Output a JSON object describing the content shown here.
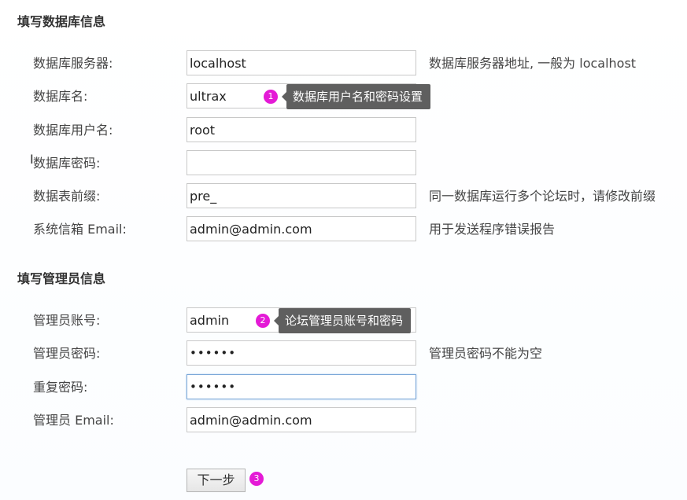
{
  "sections": {
    "database": {
      "title": "填写数据库信息"
    },
    "admin": {
      "title": "填写管理员信息"
    }
  },
  "database_fields": [
    {
      "label": "数据库服务器:",
      "value": "localhost",
      "hint": "数据库服务器地址, 一般为 localhost"
    },
    {
      "label": "数据库名:",
      "value": "ultrax",
      "hint": ""
    },
    {
      "label": "数据库用户名:",
      "value": "root",
      "hint": ""
    },
    {
      "label": "数据库密码:",
      "value": "",
      "hint": ""
    },
    {
      "label": "数据表前缀:",
      "value": "pre_",
      "hint": "同一数据库运行多个论坛时，请修改前缀"
    },
    {
      "label": "系统信箱 Email:",
      "value": "admin@admin.com",
      "hint": "用于发送程序错误报告"
    }
  ],
  "admin_fields": [
    {
      "label": "管理员账号:",
      "value": "admin",
      "hint": ""
    },
    {
      "label": "管理员密码:",
      "value": "••••••",
      "hint": "管理员密码不能为空"
    },
    {
      "label": "重复密码:",
      "value": "••••••",
      "hint": ""
    },
    {
      "label": "管理员 Email:",
      "value": "admin@admin.com",
      "hint": ""
    }
  ],
  "annotations": [
    {
      "number": "1",
      "text": "数据库用户名和密码设置"
    },
    {
      "number": "2",
      "text": "论坛管理员账号和密码"
    },
    {
      "number": "3",
      "text": ""
    }
  ],
  "next_button": {
    "label": "下一步"
  },
  "colors": {
    "badge": "#e41ad6",
    "tooltip_bg": "#5f5f5f",
    "focus_border": "#7aa7d8"
  }
}
